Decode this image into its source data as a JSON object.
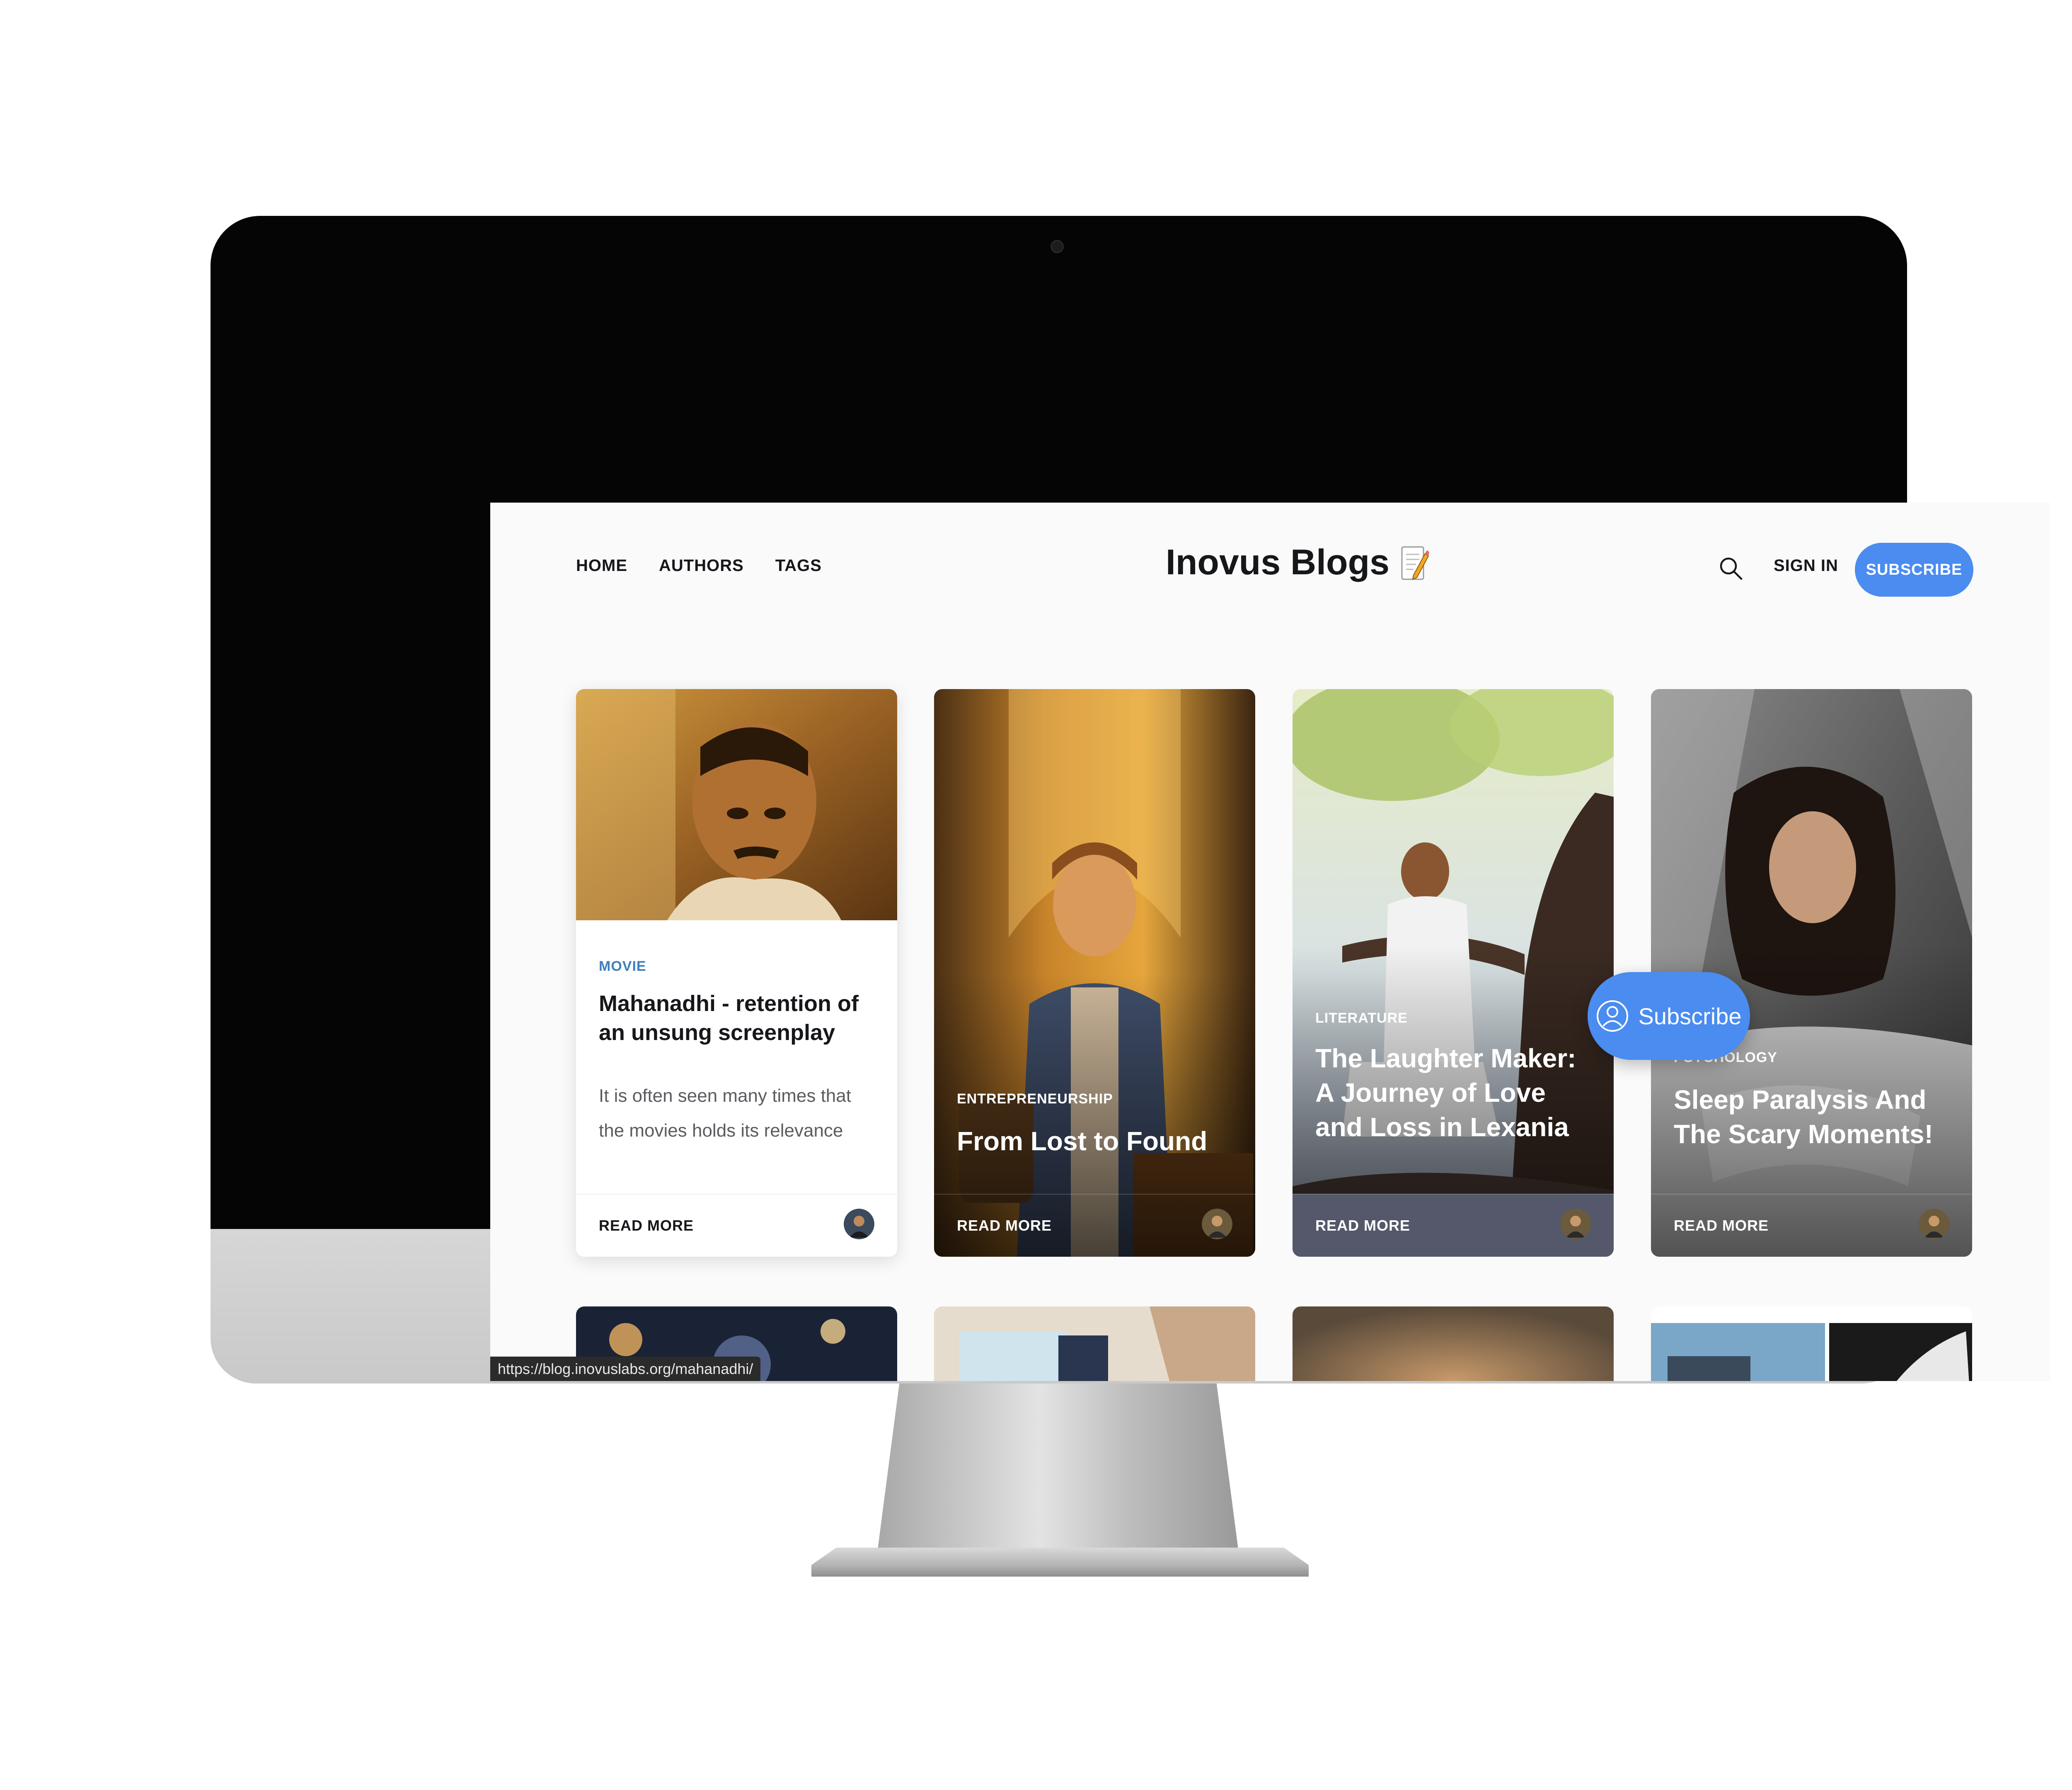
{
  "nav": {
    "home": "HOME",
    "authors": "AUTHORS",
    "tags": "TAGS"
  },
  "brand": {
    "title": "Inovus Blogs",
    "icon": "memo-icon"
  },
  "header": {
    "search_icon": "search-icon",
    "sign_in": "SIGN IN",
    "subscribe": "SUBSCRIBE"
  },
  "colors": {
    "accent": "#4a8cf0",
    "tag_blue": "#3d7fbf",
    "text_dark": "#15171a",
    "screen_bg": "#fafafa"
  },
  "posts": [
    {
      "tag": "MOVIE",
      "title": "Mahanadhi - retention of an unsung screenplay",
      "excerpt": "It is often seen many times that the movies holds its relevance",
      "read_more": "READ MORE"
    },
    {
      "tag": "ENTREPRENEURSHIP",
      "title": "From Lost to Found",
      "read_more": "READ MORE"
    },
    {
      "tag": "LITERATURE",
      "title": "The Laughter Maker: A Journey of Love and Loss in Lexania",
      "read_more": "READ MORE"
    },
    {
      "tag": "PSYCHOLOGY",
      "title": "Sleep Paralysis And The Scary Moments!",
      "read_more": "READ MORE"
    }
  ],
  "status_url": "https://blog.inovuslabs.org/mahanadhi/",
  "portal": {
    "label": "Subscribe",
    "icon": "account-icon"
  }
}
